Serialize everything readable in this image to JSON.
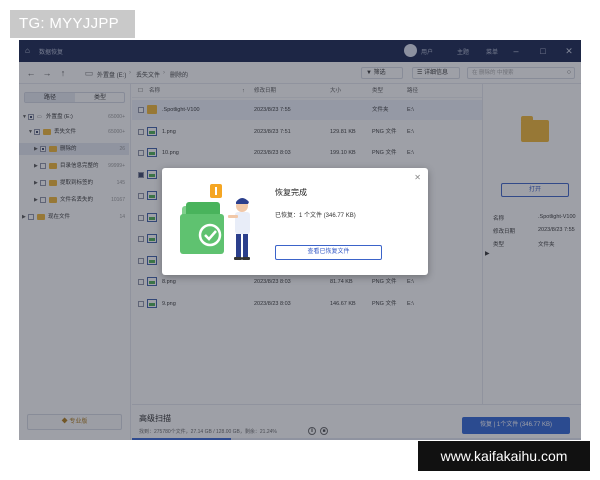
{
  "watermark": {
    "top_left": "TG: MYYJJPP",
    "bottom_right": "www.kaifakaihu.com"
  },
  "titlebar": {
    "title": "数据恢复",
    "user": "用户",
    "theme": "主题",
    "menu": "菜单"
  },
  "navbar": {
    "crumbs": [
      "外置盘 (E:)",
      "丢失文件",
      "删除的"
    ],
    "filter_label": "筛选",
    "detail_label": "详细信息",
    "search_placeholder": "在 删除的 中搜索"
  },
  "sidebar": {
    "tabs": [
      "路径",
      "类型"
    ],
    "tree": [
      {
        "name": "外置盘 (E:)",
        "count": "65000+"
      },
      {
        "name": "丢失文件",
        "count": "65000+"
      },
      {
        "name": "删除的",
        "count": "26"
      },
      {
        "name": "目录信息完整的",
        "count": "99999+"
      },
      {
        "name": "提取到标签的",
        "count": "145"
      },
      {
        "name": "文件名丢失的",
        "count": "10167"
      },
      {
        "name": "现在文件",
        "count": "14"
      }
    ],
    "pro_label": "专业版"
  },
  "table": {
    "headers": [
      "名称",
      "修改日期",
      "大小",
      "类型",
      "路径"
    ],
    "rows": [
      {
        "name": ".Spotlight-V100",
        "date": "2023/8/23 7:55",
        "size": "",
        "type": "文件夹",
        "path": "E:\\",
        "kind": "folder"
      },
      {
        "name": "1.png",
        "date": "2023/8/23 7:51",
        "size": "129.81 KB",
        "type": "PNG 文件",
        "path": "E:\\",
        "kind": "img"
      },
      {
        "name": "10.png",
        "date": "2023/8/23 8:03",
        "size": "199.10 KB",
        "type": "PNG 文件",
        "path": "E:\\",
        "kind": "img"
      },
      {
        "name": "",
        "date": "",
        "size": "",
        "type": "",
        "path": "",
        "kind": "img"
      },
      {
        "name": "",
        "date": "",
        "size": "",
        "type": "",
        "path": "",
        "kind": "img"
      },
      {
        "name": "",
        "date": "",
        "size": "",
        "type": "",
        "path": "",
        "kind": "img"
      },
      {
        "name": "",
        "date": "",
        "size": "",
        "type": "",
        "path": "",
        "kind": "img"
      },
      {
        "name": "7.png",
        "date": "2023/8/23 8:03",
        "size": "299.73 KB",
        "type": "PNG 文件",
        "path": "E:\\",
        "kind": "img"
      },
      {
        "name": "8.png",
        "date": "2023/8/23 8:03",
        "size": "81.74 KB",
        "type": "PNG 文件",
        "path": "E:\\",
        "kind": "img"
      },
      {
        "name": "9.png",
        "date": "2023/8/23 8:03",
        "size": "146.67 KB",
        "type": "PNG 文件",
        "path": "E:\\",
        "kind": "img"
      }
    ]
  },
  "preview": {
    "open_label": "打开",
    "fields": [
      {
        "k": "名称",
        "v": ".Spotlight-V100"
      },
      {
        "k": "修改日期",
        "v": "2023/8/23 7:55"
      },
      {
        "k": "类型",
        "v": "文件夹"
      }
    ]
  },
  "bottom": {
    "scan_title": "高级扫描",
    "scan_stats": "找到：275780个文件，27.14 GB / 128.00 GB，剩余：21.24%",
    "progress_fraction": 0.22,
    "recover_label": "恢复 | 1个文件 (346.77 KB)"
  },
  "dialog": {
    "title": "恢复完成",
    "message": "已恢复：1 个文件 (346.77 KB)",
    "button": "查看已恢复文件"
  },
  "colors": {
    "titlebar": "#14214d",
    "accent": "#2f64d6",
    "folder": "#f2b632",
    "illustration_green": "#49b35c"
  }
}
